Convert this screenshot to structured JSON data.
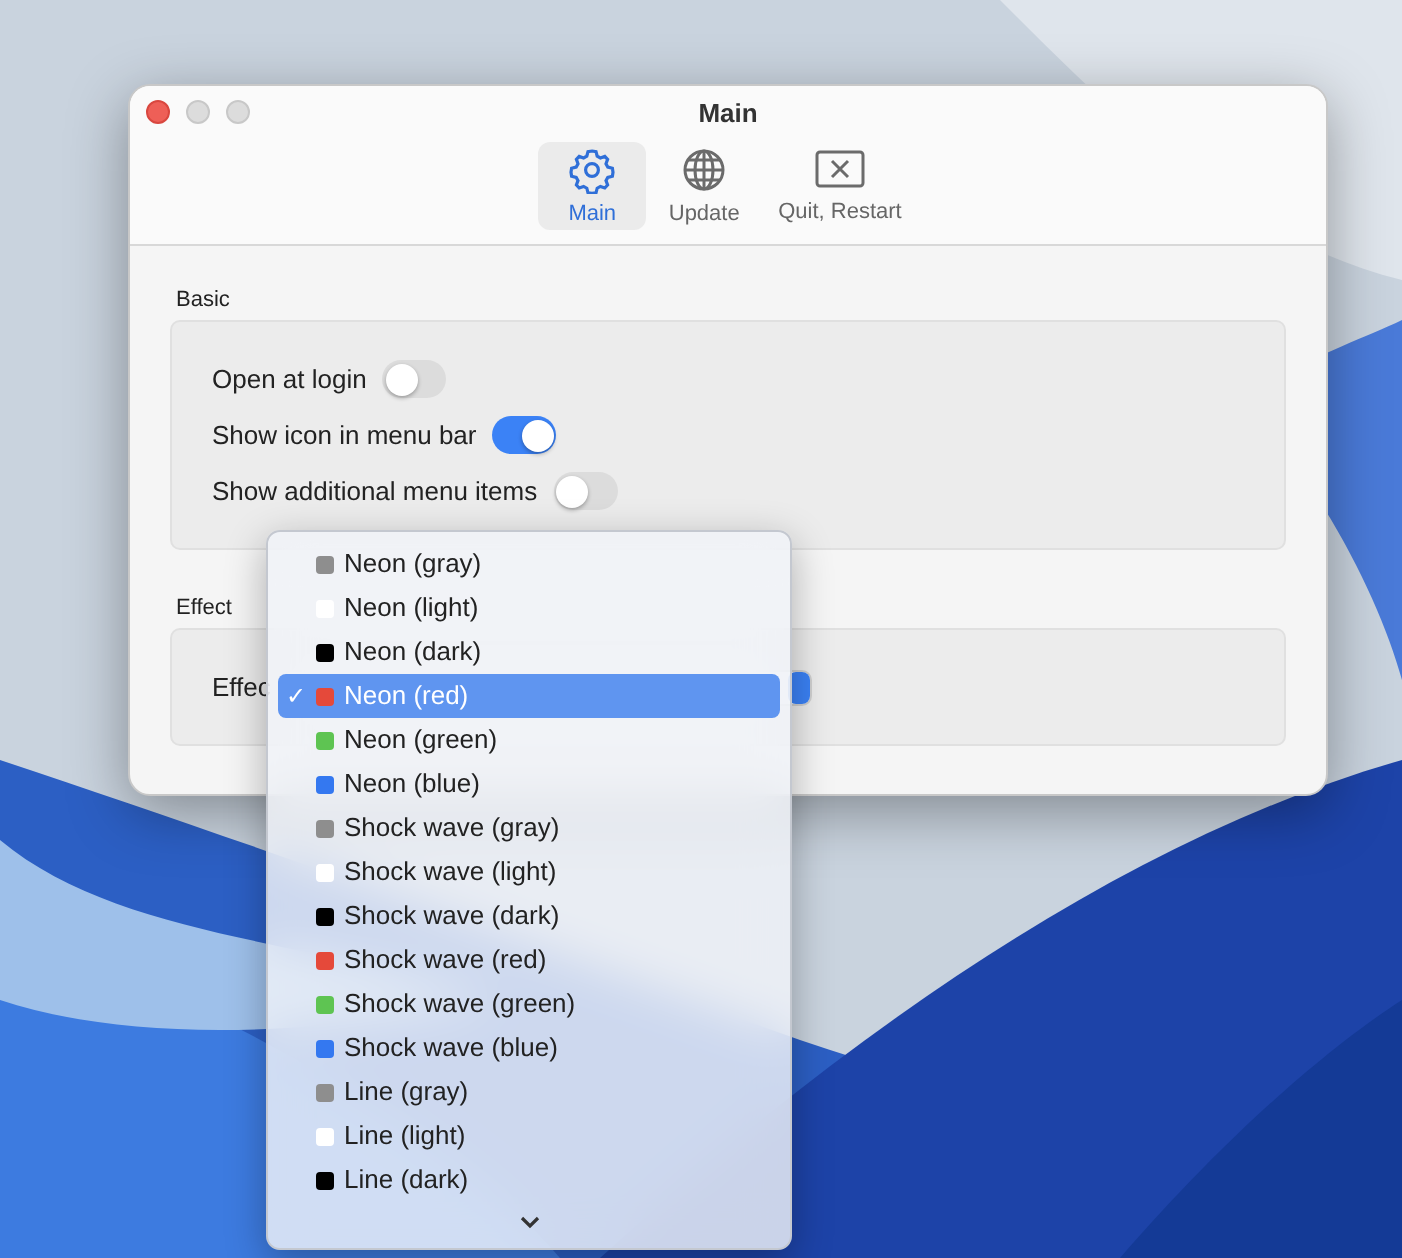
{
  "window": {
    "title": "Main"
  },
  "toolbar": [
    {
      "label": "Main",
      "kind": "settings",
      "selected": true
    },
    {
      "label": "Update",
      "kind": "globe",
      "selected": false
    },
    {
      "label": "Quit, Restart",
      "kind": "quit",
      "selected": false
    }
  ],
  "sections": [
    {
      "title": "Basic",
      "rows": [
        {
          "label": "Open at login",
          "kind": "toggle",
          "on": false
        },
        {
          "label": "Show icon in menu bar",
          "kind": "toggle",
          "on": true
        },
        {
          "label": "Show additional menu items",
          "kind": "toggle",
          "on": false
        }
      ]
    },
    {
      "title": "Effect",
      "rows": [
        {
          "label": "Effec",
          "kind": "popup"
        }
      ]
    }
  ],
  "menu": {
    "items": [
      {
        "label": "Neon (gray)",
        "color": "#8e8e8e",
        "selected": false
      },
      {
        "label": "Neon (light)",
        "color": "#ffffff",
        "selected": false
      },
      {
        "label": "Neon (dark)",
        "color": "#000000",
        "selected": false
      },
      {
        "label": "Neon (red)",
        "color": "#e5493a",
        "selected": true
      },
      {
        "label": "Neon (green)",
        "color": "#5ec452",
        "selected": false
      },
      {
        "label": "Neon (blue)",
        "color": "#3478f0",
        "selected": false
      },
      {
        "label": "Shock wave (gray)",
        "color": "#8e8e8e",
        "selected": false
      },
      {
        "label": "Shock wave (light)",
        "color": "#ffffff",
        "selected": false
      },
      {
        "label": "Shock wave (dark)",
        "color": "#000000",
        "selected": false
      },
      {
        "label": "Shock wave (red)",
        "color": "#e5493a",
        "selected": false
      },
      {
        "label": "Shock wave (green)",
        "color": "#5ec452",
        "selected": false
      },
      {
        "label": "Shock wave (blue)",
        "color": "#3478f0",
        "selected": false
      },
      {
        "label": "Line (gray)",
        "color": "#8e8e8e",
        "selected": false
      },
      {
        "label": "Line (light)",
        "color": "#ffffff",
        "selected": false
      },
      {
        "label": "Line (dark)",
        "color": "#000000",
        "selected": false
      }
    ],
    "check": "✓"
  }
}
